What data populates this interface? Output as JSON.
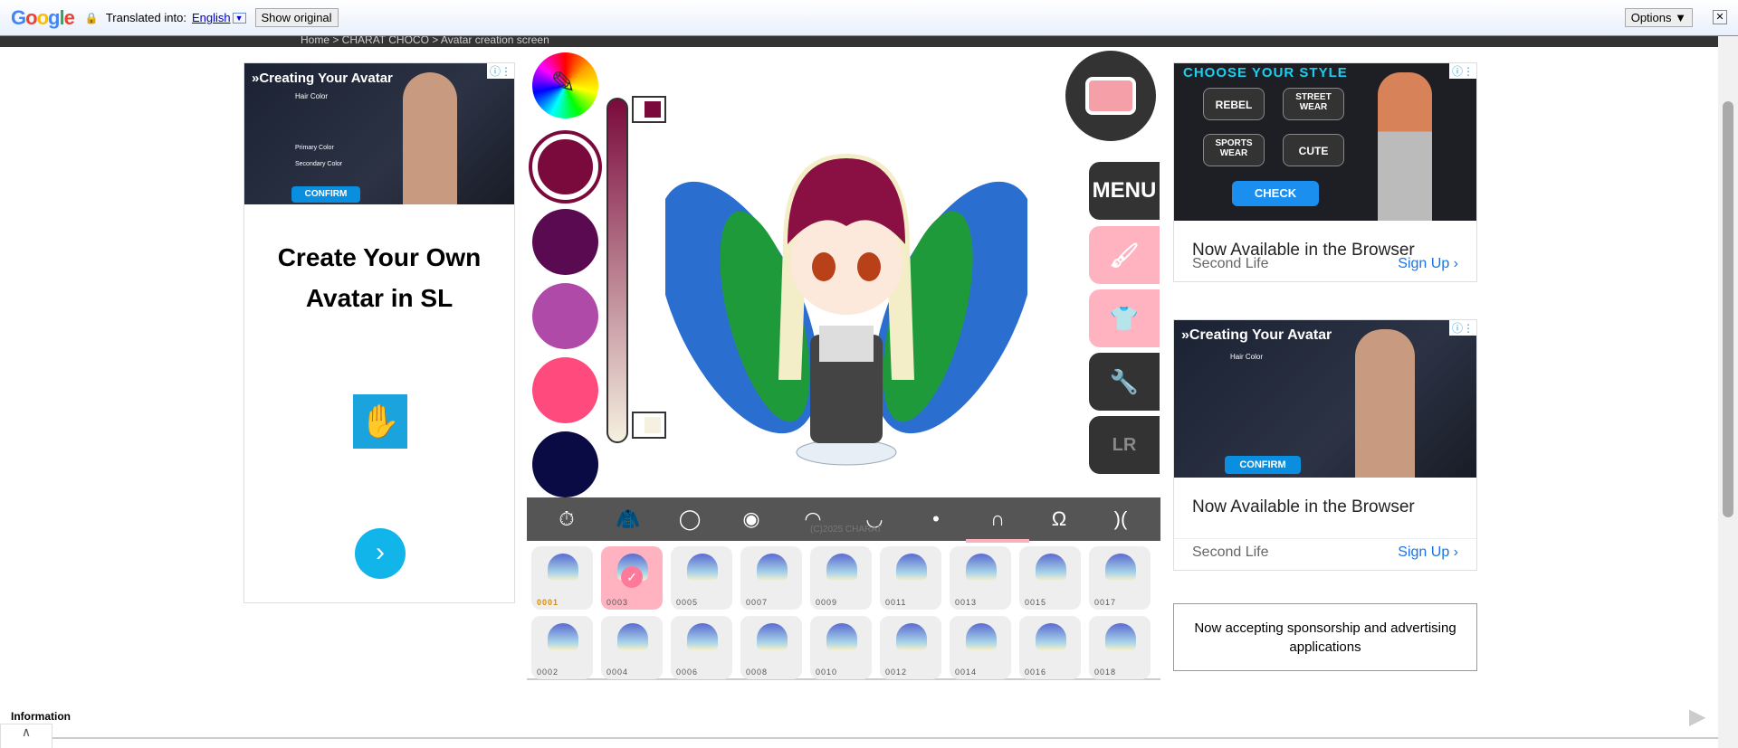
{
  "translate_bar": {
    "logo": "Google",
    "translated_into": "Translated into:",
    "language": "English",
    "show_original": "Show original",
    "options": "Options ▼",
    "close": "✕"
  },
  "breadcrumb": "Home  >  CHARAT CHOCO  >  Avatar creation screen",
  "left_ad": {
    "banner_title": "»Creating Your Avatar",
    "hair_color": "Hair Color",
    "primary_color": "Primary Color",
    "secondary_color": "Secondary Color",
    "confirm": "CONFIRM",
    "headline": "Create Your Own Avatar in SL"
  },
  "palette": {
    "colors": [
      "#7a0a3c",
      "#5a0a50",
      "#b04aa8",
      "#ff4a7d",
      "#0a0a45"
    ],
    "slider_top": "#7a0a3c",
    "slider_bottom": "#f5f0e0"
  },
  "right_buttons": {
    "menu": "MENU"
  },
  "tabs": [
    "accessory",
    "outfit",
    "face",
    "eyes",
    "eyebrows",
    "mouth",
    "nose",
    "hair",
    "back-hair",
    "ears"
  ],
  "active_tab": 7,
  "copyright": "(C)2025 CHARAT",
  "hair_items_top": [
    "0001",
    "0003",
    "0005",
    "0007",
    "0009",
    "0011",
    "0013",
    "0015",
    "0017"
  ],
  "hair_items_bottom": [
    "0002",
    "0004",
    "0006",
    "0008",
    "0010",
    "0012",
    "0014",
    "0016",
    "0018"
  ],
  "selected_item": "0003",
  "right_ad1": {
    "title": "CHOOSE YOUR STYLE",
    "options": [
      "REBEL",
      "STREET WEAR",
      "SPORTS WEAR",
      "CUTE"
    ],
    "check": "CHECK",
    "headline": "Now Available in the Browser",
    "brand": "Second Life",
    "signup": "Sign Up"
  },
  "right_ad2": {
    "banner_title": "»Creating Your Avatar",
    "hair_color": "Hair Color",
    "confirm": "CONFIRM",
    "headline": "Now Available in the Browser",
    "brand": "Second Life",
    "signup": "Sign Up"
  },
  "sponsorship": "Now accepting sponsorship and advertising applications",
  "footer": {
    "information": "Information"
  }
}
